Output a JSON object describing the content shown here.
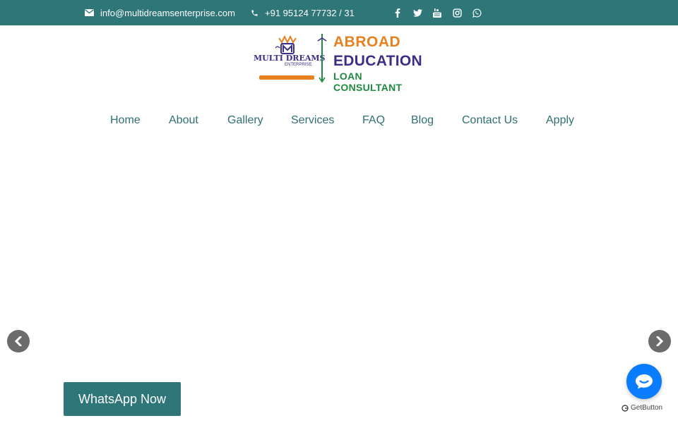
{
  "topbar": {
    "email": "info@multidreamsenterprise.com",
    "phone": "+91 95124 77732 / 31",
    "icons": {
      "email": "envelope-icon",
      "phone": "phone-icon",
      "social": [
        "facebook-icon",
        "twitter-icon",
        "youtube-icon",
        "instagram-icon",
        "whatsapp-icon"
      ]
    }
  },
  "logo": {
    "brand": "MULTI DREAMS",
    "brand_sub": "ENTERPRISE",
    "line1": "ABROAD",
    "line2": "EDUCATION",
    "line3": "LOAN CONSULTANT"
  },
  "nav": {
    "items": [
      {
        "label": "Home"
      },
      {
        "label": "About"
      },
      {
        "label": "Gallery"
      },
      {
        "label": "Services"
      },
      {
        "label": "FAQ"
      },
      {
        "label": "Blog"
      },
      {
        "label": "Contact Us"
      },
      {
        "label": "Apply"
      }
    ]
  },
  "slider": {
    "prev_icon": "chevron-left-icon",
    "next_icon": "chevron-right-icon"
  },
  "cta": {
    "whatsapp_label": "WhatsApp Now"
  },
  "widget": {
    "chat_icon": "chat-bubble-icon",
    "brand_label": "GetButton"
  },
  "colors": {
    "primary": "#2f7678",
    "nav_text": "#2f6f72",
    "abroad": "#e7811f",
    "education": "#3a2f86",
    "loan": "#1f8a3f",
    "chat": "#0a7cff"
  }
}
